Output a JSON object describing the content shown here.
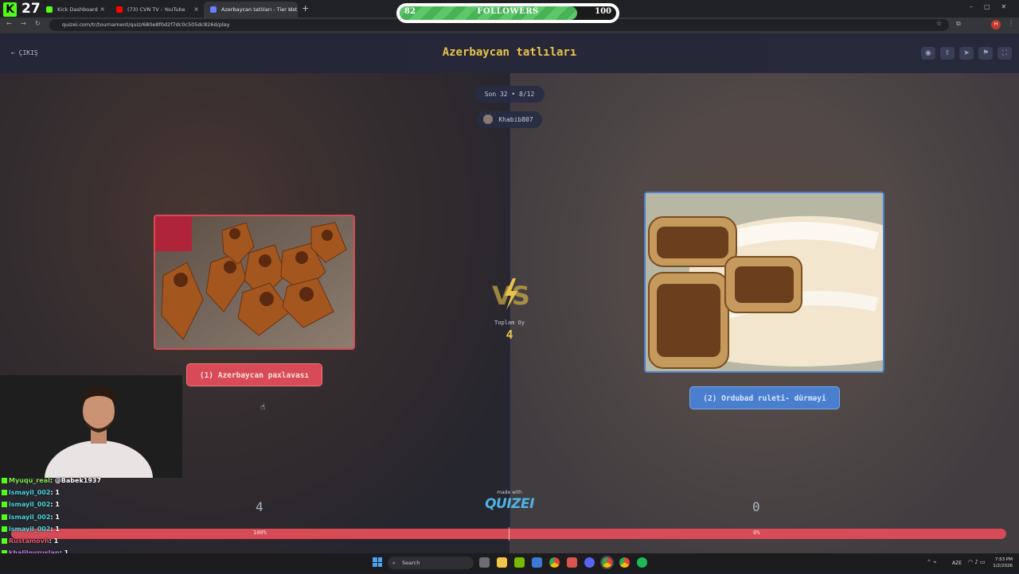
{
  "browser": {
    "tabs": [
      {
        "label": "Kick Dashboard",
        "fav_color": "#53fc18"
      },
      {
        "label": "(73) CVN TV - YouTube",
        "fav_color": "#ff0000"
      },
      {
        "label": "Azerbaycan tatlıları - Tier List, ...",
        "fav_color": "#6b7cff"
      }
    ],
    "url": "quizei.com/tr/tournament/quiz/680e8f0d2f7dc0c505dc826d/play"
  },
  "overlay": {
    "kick_count": "27",
    "followers": {
      "current": "82",
      "label": "FOLLOWERS",
      "goal": "100",
      "progress": 0.82
    }
  },
  "header": {
    "back_label": "ÇIKIŞ",
    "title": "Azerbaycan tatlıları",
    "icons": [
      "eye-icon",
      "share-icon",
      "send-icon",
      "flag-icon",
      "fullscreen-icon"
    ]
  },
  "round": {
    "label": "Son 32 • 8/12",
    "user": "Khabib807"
  },
  "left": {
    "label": "(1) Azerbaycan paxlavası",
    "score": "4",
    "percent": "100%",
    "color": "#d84a55"
  },
  "right": {
    "label": "(2) Ordubad ruleti- dürməyi",
    "score": "0",
    "percent": "0%",
    "color": "#4a7fd0"
  },
  "center": {
    "vs": "VS",
    "total_label": "Toplam Oy",
    "total_value": "4",
    "made_with": "made with",
    "logo": "QUIZEI"
  },
  "chat": [
    {
      "user": "Myuqu_real",
      "msg": "@Babek1937",
      "color": "#7ee84a"
    },
    {
      "user": "ismayil_002",
      "msg": "1",
      "color": "#4bd4e0"
    },
    {
      "user": "ismayil_002",
      "msg": "1",
      "color": "#4bd4e0"
    },
    {
      "user": "ismayil_002",
      "msg": "1",
      "color": "#4bd4e0"
    },
    {
      "user": "ismayil_002",
      "msg": "1",
      "color": "#4bd4e0"
    },
    {
      "user": "Rustamovh",
      "msg": "1",
      "color": "#e0576a"
    },
    {
      "user": "khalilovruslan",
      "msg": "1",
      "color": "#c27be8"
    },
    {
      "user": "Myuqu_real",
      "msg": "1",
      "color": "#7ee84a"
    }
  ],
  "taskbar": {
    "search_placeholder": "Search",
    "lang": "AZE",
    "time": "7:53 PM",
    "date": "1/2/2026"
  }
}
